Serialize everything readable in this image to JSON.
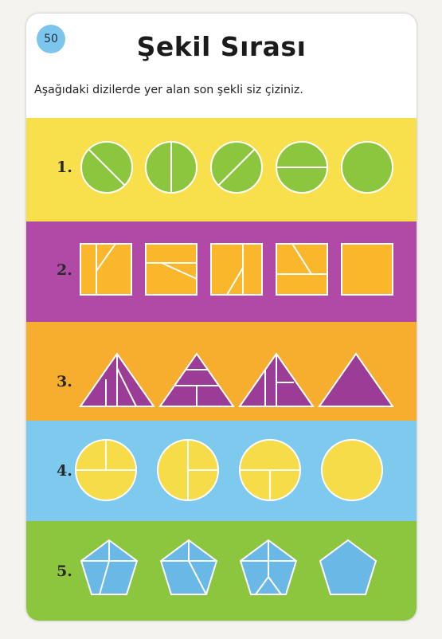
{
  "page": {
    "number": "50",
    "title": "Şekil Sırası",
    "instruction": "Aşağıdaki dizilerde yer alan son şekli siz çiziniz."
  },
  "rows": [
    {
      "label": "1.",
      "band_color": "#f8e04c",
      "shape": "circle",
      "shape_color": "#8cc63f",
      "count": 5
    },
    {
      "label": "2.",
      "band_color": "#b04aa6",
      "shape": "square",
      "shape_color": "#fbb72b",
      "count": 5
    },
    {
      "label": "3.",
      "band_color": "#f7ad2d",
      "shape": "triangle",
      "shape_color": "#9b3c96",
      "count": 4
    },
    {
      "label": "4.",
      "band_color": "#7dcaee",
      "shape": "circle",
      "shape_color": "#f7dc4a",
      "count": 4
    },
    {
      "label": "5.",
      "band_color": "#8cc63f",
      "shape": "pentagon",
      "shape_color": "#69b8e5",
      "count": 4
    }
  ]
}
